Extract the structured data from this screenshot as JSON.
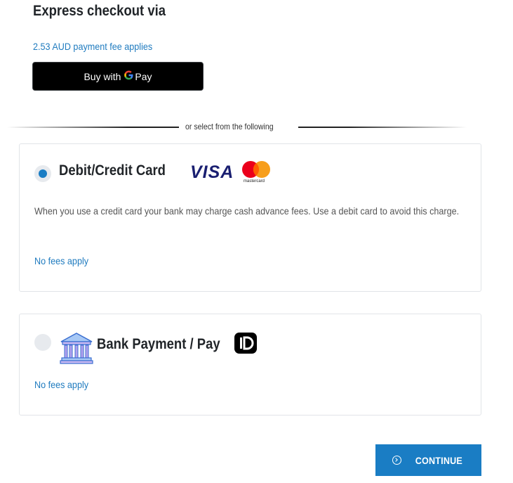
{
  "express": {
    "title": "Express checkout via",
    "fee_text": "2.53 AUD payment fee applies",
    "gpay_label": "Buy with",
    "gpay_g": "G",
    "gpay_pay": "Pay"
  },
  "divider": {
    "text": "or select from the following"
  },
  "payment_options": [
    {
      "title": "Debit/Credit Card",
      "selected": true,
      "brand_visa": "VISA",
      "brand_mastercard": "mastercard",
      "description": "When you use a credit card your bank may charge cash advance fees. Use a debit card to avoid this charge.",
      "fee_text": "No fees apply"
    },
    {
      "title": "Bank Payment / Pay",
      "selected": false,
      "fee_text": "No fees apply"
    }
  ],
  "continue_label": "CONTINUE",
  "colors": {
    "accent": "#1a7dc4",
    "link": "#1f7bbf",
    "visa": "#1a1f71"
  }
}
